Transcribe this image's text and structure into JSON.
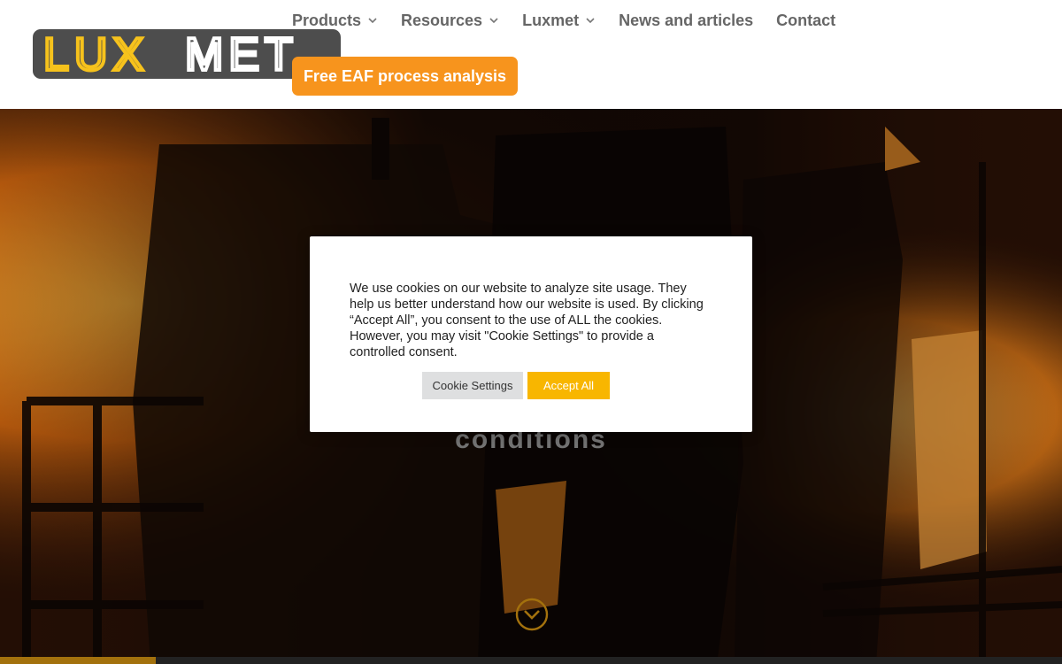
{
  "brand": {
    "logo_text": "LUXMET",
    "logo_part1": "LUX",
    "logo_part2": "MET",
    "logo_bg": "#4d4d4d",
    "accent": "#f6c21c"
  },
  "nav": {
    "items": [
      {
        "label": "Products",
        "has_dropdown": true
      },
      {
        "label": "Resources",
        "has_dropdown": true
      },
      {
        "label": "Luxmet",
        "has_dropdown": true
      },
      {
        "label": "News and articles",
        "has_dropdown": false
      },
      {
        "label": "Contact",
        "has_dropdown": false
      }
    ],
    "cta_label": "Free EAF process analysis",
    "cta_color": "#f7941d"
  },
  "hero": {
    "headline_fragment": "conditions",
    "scroll_icon": "chevron-down-circle-icon",
    "progress_fraction": 0.147
  },
  "cookie_banner": {
    "message": "We use cookies on our website to analyze site usage. They help us better understand how our website is used. By clicking “Accept All”, you consent to the use of ALL the cookies. However, you may visit \"Cookie Settings\" to provide a controlled consent.",
    "settings_label": "Cookie Settings",
    "accept_label": "Accept All",
    "accept_color": "#f8b600"
  }
}
